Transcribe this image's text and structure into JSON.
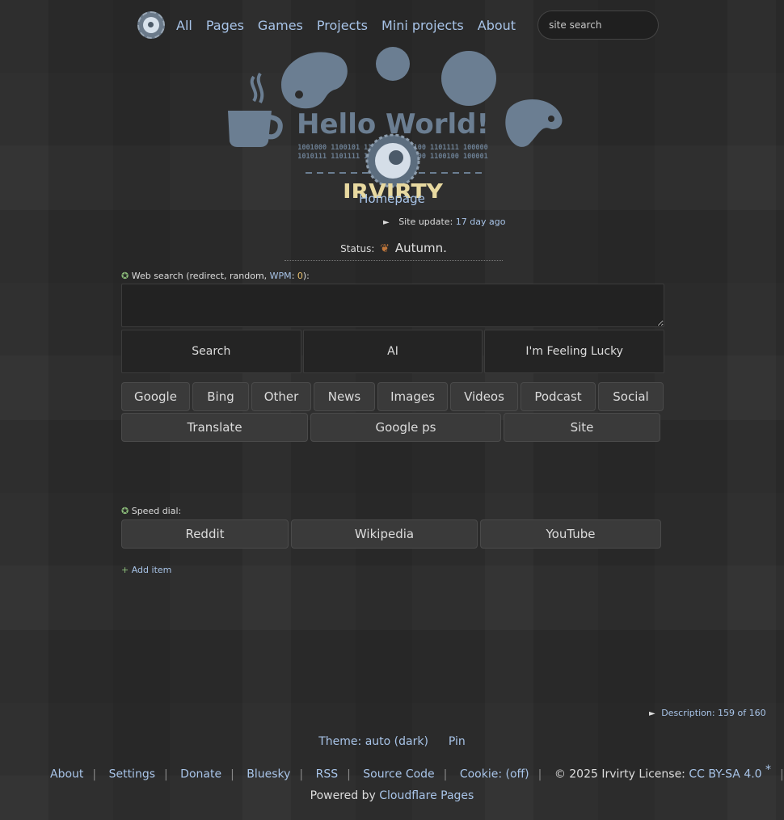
{
  "nav": {
    "links": [
      "All",
      "Pages",
      "Games",
      "Projects",
      "Mini projects",
      "About"
    ],
    "search_placeholder": "site search"
  },
  "banner": {
    "headline": "Hello World!",
    "binary_lines": [
      "1001000 1100101 1101100 1101100 1101111 100000",
      "1010111 1101111 1110010 1101100 1100100 100001"
    ],
    "brand": "IRVIRTY"
  },
  "home_title": "Homepage",
  "site_update": {
    "label": "Site update:",
    "value": "17 day ago"
  },
  "status": {
    "label": "Status:",
    "value": "Autumn."
  },
  "web_search": {
    "label_prefix": "Web search (redirect, random, ",
    "wpm_label": "WPM",
    "wpm_value": "0",
    "label_suffix": "):",
    "buttons": [
      "Search",
      "AI",
      "I'm Feeling Lucky"
    ]
  },
  "engines_row1": [
    "Google",
    "Bing",
    "Other",
    "News",
    "Images",
    "Videos",
    "Podcast",
    "Social"
  ],
  "engines_row2": [
    "Translate",
    "Google ps",
    "Site"
  ],
  "speed_dial": {
    "label": "Speed dial:",
    "items": [
      "Reddit",
      "Wikipedia",
      "YouTube"
    ],
    "add_label": "Add item"
  },
  "description": {
    "label": "Description: 159 of 160"
  },
  "theme": {
    "label": "Theme: auto (dark)",
    "pin": "Pin"
  },
  "footer": {
    "links": [
      "About",
      "Settings",
      "Donate",
      "Bluesky",
      "RSS",
      "Source Code",
      "Cookie: (off)"
    ],
    "copyright": "© 2025 Irvirty License: ",
    "license": "CC BY-SA 4.0",
    "star": "*",
    "powered_prefix": "Powered by ",
    "powered_link": "Cloudflare Pages"
  }
}
